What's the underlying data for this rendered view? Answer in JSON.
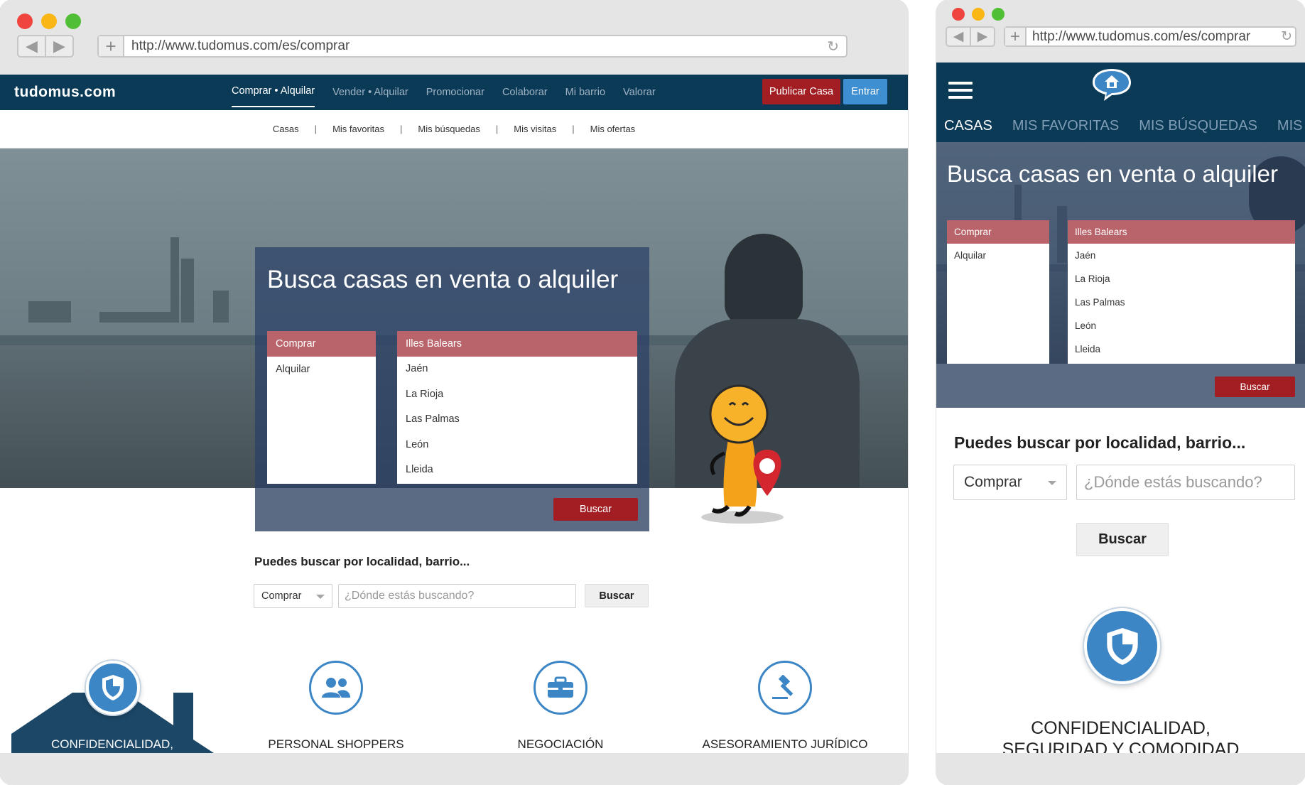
{
  "desktop": {
    "url": "http://www.tudomus.com/es/comprar",
    "logo": "tudomus.com",
    "menu": [
      "Comprar • Alquilar",
      "Vender • Alquilar",
      "Promocionar",
      "Colaborar",
      "Mi barrio",
      "Valorar"
    ],
    "publish_label": "Publicar Casa",
    "login_label": "Entrar",
    "subnav": [
      "Casas",
      "Mis favoritas",
      "Mis búsquedas",
      "Mis visitas",
      "Mis ofertas"
    ],
    "hero_title": "Busca casas en venta o alquiler",
    "operations": {
      "selected": "Comprar",
      "others": [
        "Alquilar"
      ]
    },
    "provinces": {
      "selected": "Illes Balears",
      "others": [
        "Jaén",
        "La Rioja",
        "Las Palmas",
        "León",
        "Lleida"
      ]
    },
    "search_button": "Buscar",
    "search_title": "Puedes buscar por localidad, barrio...",
    "select_value": "Comprar",
    "input_placeholder": "¿Dónde estás buscando?",
    "search_button2": "Buscar",
    "features": [
      "CONFIDENCIALIDAD,",
      "PERSONAL SHOPPERS",
      "NEGOCIACIÓN",
      "ASESORAMIENTO JURÍDICO"
    ]
  },
  "mobile": {
    "url": "http://www.tudomus.com/es/comprar",
    "tabs": [
      "CASAS",
      "MIS FAVORITAS",
      "MIS BÚSQUEDAS",
      "MIS VISIT."
    ],
    "hero_title": "Busca casas en venta o alquiler",
    "operations": {
      "selected": "Comprar",
      "others": [
        "Alquilar"
      ]
    },
    "provinces": {
      "selected": "Illes Balears",
      "others": [
        "Jaén",
        "La Rioja",
        "Las Palmas",
        "León",
        "Lleida"
      ]
    },
    "search_button": "Buscar",
    "search_title": "Puedes buscar por localidad, barrio...",
    "select_value": "Comprar",
    "input_placeholder": "¿Dónde estás buscando?",
    "search_button2": "Buscar",
    "feature_line1": "CONFIDENCIALIDAD,",
    "feature_line2": "SEGURIDAD Y COMODIDAD"
  },
  "colors": {
    "navy": "#0b3a57",
    "brand_red": "#a21e23",
    "accent_blue": "#3d86c6",
    "list_head": "#b9646a"
  }
}
